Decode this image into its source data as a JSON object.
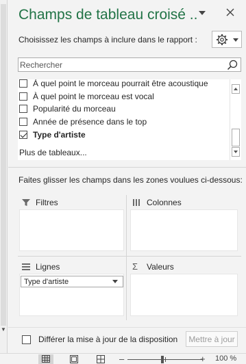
{
  "pane": {
    "title": "Champs de tableau croisé ..",
    "subtitle": "Choisissez les champs à inclure dans le rapport :",
    "accent_color": "#217346"
  },
  "search": {
    "placeholder": "Rechercher",
    "icon": "search-icon"
  },
  "fields": {
    "items": [
      {
        "label": "À quel point le morceau pourrait être acoustique",
        "checked": false,
        "bold": false
      },
      {
        "label": "À quel point le morceau est vocal",
        "checked": false,
        "bold": false
      },
      {
        "label": "Popularité du morceau",
        "checked": false,
        "bold": false
      },
      {
        "label": "Année de présence dans le top",
        "checked": false,
        "bold": false
      },
      {
        "label": "Type d'artiste",
        "checked": true,
        "bold": true
      }
    ],
    "more_tables": "Plus de tableaux..."
  },
  "areas": {
    "hint": "Faites glisser les champs dans les zones voulues ci-dessous:",
    "filters": "Filtres",
    "columns": "Colonnes",
    "rows": "Lignes",
    "values": "Valeurs",
    "values_symbol": "Σ",
    "row_items": [
      "Type d'artiste"
    ]
  },
  "footer": {
    "defer_label": "Différer la mise à jour de la disposition",
    "defer_checked": false,
    "update_button": "Mettre à jour"
  },
  "status": {
    "zoom_minus": "–",
    "zoom_plus": "+",
    "zoom_level": "100 %",
    "views": [
      "normal-view-icon",
      "page-layout-view-icon",
      "page-break-view-icon"
    ]
  }
}
